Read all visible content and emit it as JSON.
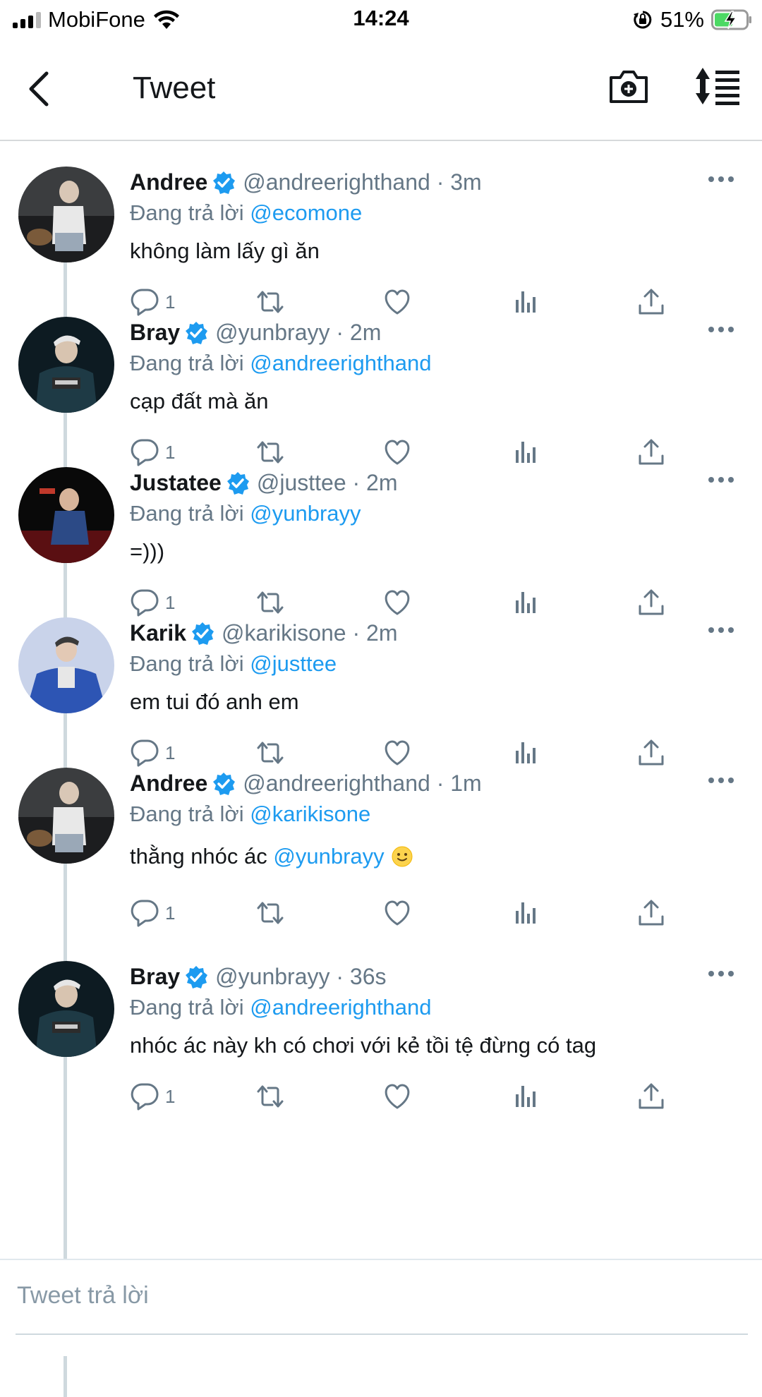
{
  "status_bar": {
    "carrier": "MobiFone",
    "time": "14:24",
    "battery": "51%"
  },
  "nav": {
    "title": "Tweet"
  },
  "colors": {
    "accent": "#1d9bf0",
    "secondary_text": "#657786",
    "primary_text": "#14171a"
  },
  "tweets": [
    {
      "name": "Andree",
      "handle": "@andreerighthand",
      "time": "3m",
      "replying_label": "Đang trả lời",
      "replying_to": "@ecomone",
      "text": "không làm lấy gì ăn",
      "mention": "",
      "emoji": "",
      "reply_count": "1"
    },
    {
      "name": "Bray",
      "handle": "@yunbrayy",
      "time": "2m",
      "replying_label": "Đang trả lời",
      "replying_to": "@andreerighthand",
      "text": "cạp đất mà ăn",
      "mention": "",
      "emoji": "",
      "reply_count": "1"
    },
    {
      "name": "Justatee",
      "handle": "@justtee",
      "time": "2m",
      "replying_label": "Đang trả lời",
      "replying_to": "@yunbrayy",
      "text": "=)))",
      "mention": "",
      "emoji": "",
      "reply_count": "1"
    },
    {
      "name": "Karik",
      "handle": "@karikisone",
      "time": "2m",
      "replying_label": "Đang trả lời",
      "replying_to": "@justtee",
      "text": "em tui đó anh em",
      "mention": "",
      "emoji": "",
      "reply_count": "1"
    },
    {
      "name": "Andree",
      "handle": "@andreerighthand",
      "time": "1m",
      "replying_label": "Đang trả lời",
      "replying_to": "@karikisone",
      "text": "thằng nhóc ác",
      "mention": "@yunbrayy",
      "emoji": "slightly-smiling-face",
      "reply_count": "1"
    },
    {
      "name": "Bray",
      "handle": "@yunbrayy",
      "time": "36s",
      "replying_label": "Đang trả lời",
      "replying_to": "@andreerighthand",
      "text": "nhóc ác này kh có chơi với kẻ tồi tệ đừng có tag",
      "mention": "",
      "emoji": "",
      "reply_count": "1"
    }
  ],
  "composer": {
    "placeholder": "Tweet trả lời"
  },
  "icons": {
    "nav_back": "chevron-left-icon",
    "nav_camera": "camera-plus-icon",
    "nav_sort": "sort-lines-icon",
    "verified": "verified-badge-icon",
    "more": "more-dots-icon",
    "reply": "reply-bubble-icon",
    "retweet": "retweet-icon",
    "like": "heart-icon",
    "views": "analytics-bars-icon",
    "share": "share-upload-icon"
  }
}
